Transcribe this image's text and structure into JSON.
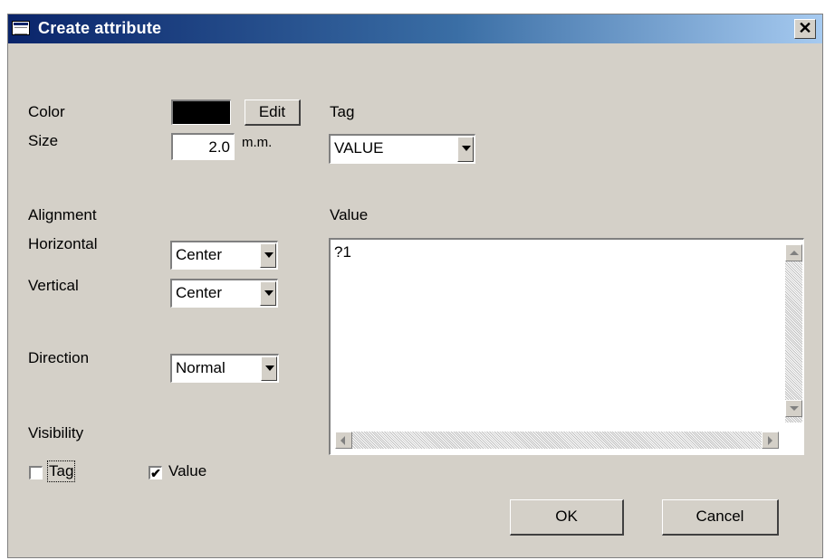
{
  "window": {
    "title": "Create attribute"
  },
  "title_controls": {
    "close": "✕"
  },
  "color": {
    "label": "Color",
    "edit_button": "Edit",
    "swatch": "#000000"
  },
  "size": {
    "label": "Size",
    "value": "2.0",
    "unit": "m.m."
  },
  "tag": {
    "label": "Tag",
    "selected": "VALUE"
  },
  "alignment": {
    "label": "Alignment",
    "horizontal": {
      "label": "Horizontal",
      "selected": "Center"
    },
    "vertical": {
      "label": "Vertical",
      "selected": "Center"
    }
  },
  "direction": {
    "label": "Direction",
    "selected": "Normal"
  },
  "value": {
    "label": "Value",
    "text": "?1"
  },
  "visibility": {
    "label": "Visibility",
    "tag_checkbox": {
      "label": "Tag",
      "checked": false
    },
    "value_checkbox": {
      "label": "Value",
      "checked": true
    }
  },
  "buttons": {
    "ok": "OK",
    "cancel": "Cancel"
  },
  "icons": {
    "window": "window-icon",
    "close": "close-icon",
    "checkmark": "✔"
  }
}
